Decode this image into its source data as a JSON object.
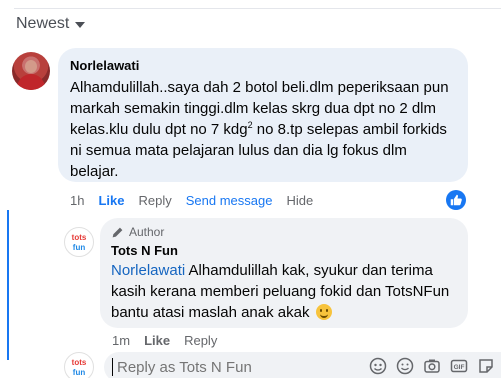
{
  "sort": {
    "label": "Newest"
  },
  "comment": {
    "author": "Norlelawati",
    "text_before_sup": "Alhamdulillah..saya dah 2 botol beli.dlm peperiksaan pun markah semakin tinggi.dlm kelas skrg dua dpt no 2 dlm kelas.klu dulu dpt no 7 kdg",
    "sup": "2",
    "text_after_sup": " no 8.tp selepas ambil forkids ni semua mata pelajaran lulus dan dia lg fokus dlm belajar.",
    "time": "1h",
    "actions": {
      "like": "Like",
      "reply": "Reply",
      "send_message": "Send message",
      "hide": "Hide"
    }
  },
  "reply": {
    "author_badge": "Author",
    "author": "Tots N Fun",
    "mention": "Norlelawati",
    "text": " Alhamdulillah kak, syukur dan terima kasih kerana memberi peluang fokid dan TotsNFun bantu atasi maslah anak akak ",
    "time": "1m",
    "actions": {
      "like": "Like",
      "reply": "Reply"
    }
  },
  "compose": {
    "placeholder": "Reply as Tots N Fun"
  },
  "colors": {
    "accent": "#1877f2",
    "bubble": "#eaf0f8",
    "muted": "#65676b"
  },
  "icons": [
    "caret-down-icon",
    "thumbs-up-icon",
    "pencil-icon",
    "sticker-icon",
    "emoji-icon",
    "camera-icon",
    "gif-icon",
    "sticker-alt-icon"
  ]
}
